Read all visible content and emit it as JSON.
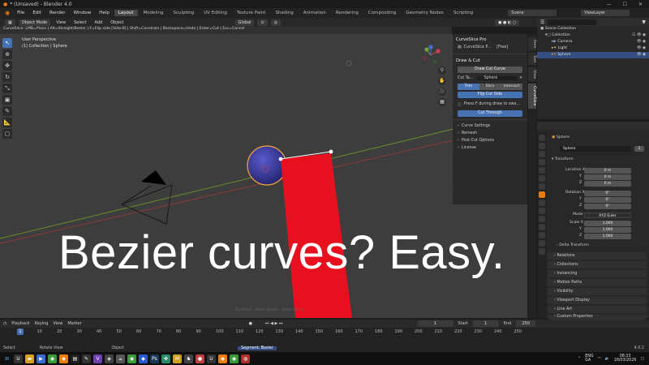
{
  "window": {
    "title": "* (Unsaved) - Blender 4.0",
    "controls": [
      "—",
      "☐",
      "✕"
    ]
  },
  "menu": {
    "items": [
      "File",
      "Edit",
      "Render",
      "Window",
      "Help"
    ],
    "workspaces": [
      "Layout",
      "Modeling",
      "Sculpting",
      "UV Editing",
      "Texture Paint",
      "Shading",
      "Animation",
      "Rendering",
      "Compositing",
      "Geometry Nodes",
      "Scripting"
    ],
    "active_workspace": "Layout",
    "scene": "Scene",
    "view_layer": "ViewLayer"
  },
  "header": {
    "mode": "Object Mode",
    "view": "View",
    "select": "Select",
    "add": "Add",
    "object": "Object",
    "orientation": "Global"
  },
  "status_hint": "CurveSlice: LMB=Place | Alt=Straight/Bezier | F=Flip side [Side:B] | Shift=Constrain | Backspace=Undo | Enter=Cut | Esc=Cancel",
  "viewport": {
    "perspective": "User Perspective",
    "collection": "(1) Collection | Sphere",
    "overlay_text": "Bezier curves? Easy.",
    "hint": "Z=Points · Next: Bezier · Enter to cut"
  },
  "npanel": {
    "title": "CurveSlice Pro",
    "plugin_label": "CurveSlice P...",
    "plugin_tier": "[Free]",
    "section_draw": "Draw & Cut",
    "draw_btn": "Draw Cut Curve",
    "cut_target_label": "Cut Ta...",
    "cut_target_value": "Sphere",
    "modes": [
      "Trim",
      "Slice",
      "Intersect"
    ],
    "active_mode": "Trim",
    "flip_btn": "Flip Cut Side",
    "flip_hint": "Press F during draw to swa...",
    "through_btn": "Cut Through",
    "subsections": [
      "Curve Settings",
      "Remesh",
      "Post-Cut Options",
      "License"
    ]
  },
  "ntabs": [
    "Item",
    "Tool",
    "View",
    "CurveSlice"
  ],
  "outliner": {
    "scene_collection": "Scene Collection",
    "rows": [
      "Collection",
      "Camera",
      "Light",
      "Sphere"
    ],
    "selected": "Sphere"
  },
  "properties": {
    "object_name": "Sphere",
    "data_name": "Sphere",
    "transform": "Transform",
    "location": {
      "label": "Location X",
      "y": "Y",
      "z": "Z",
      "values": [
        "0 m",
        "0 m",
        "0 m"
      ]
    },
    "rotation": {
      "label": "Rotation X",
      "y": "Y",
      "z": "Z",
      "values": [
        "0°",
        "0°",
        "0°"
      ]
    },
    "mode_label": "Mode",
    "mode_value": "XYZ Euler",
    "scale": {
      "label": "Scale X",
      "y": "Y",
      "z": "Z",
      "values": [
        "1.000",
        "1.000",
        "1.000"
      ]
    },
    "sections": [
      "Delta Transform",
      "Relations",
      "Collections",
      "Instancing",
      "Motion Paths",
      "Visibility",
      "Viewport Display",
      "Line Art",
      "Custom Properties"
    ],
    "user_count": "2"
  },
  "timeline": {
    "menu": [
      "Playback",
      "Keying",
      "View",
      "Marker"
    ],
    "current_frame": "1",
    "start_label": "Start",
    "start": "1",
    "end_label": "End",
    "end": "250",
    "ticks": [
      "1",
      "10",
      "20",
      "30",
      "40",
      "50",
      "60",
      "70",
      "80",
      "90",
      "100",
      "110",
      "120",
      "130",
      "140",
      "150",
      "160",
      "170",
      "180",
      "190",
      "200",
      "210",
      "220",
      "230",
      "240",
      "250"
    ]
  },
  "statusbar": {
    "select": "Select",
    "rotate": "Rotate View",
    "object": "Object",
    "segment": "Segment: Bezier",
    "version": "4.0.2"
  },
  "taskbar": {
    "lang1": "ENG",
    "lang2": "GA",
    "time": "08:33",
    "date": "18/03/2026"
  },
  "colors": {
    "accent": "#4772b3",
    "red_plane": "#e8101e",
    "sphere": "#3a3aa0",
    "selection": "#f4a640"
  }
}
